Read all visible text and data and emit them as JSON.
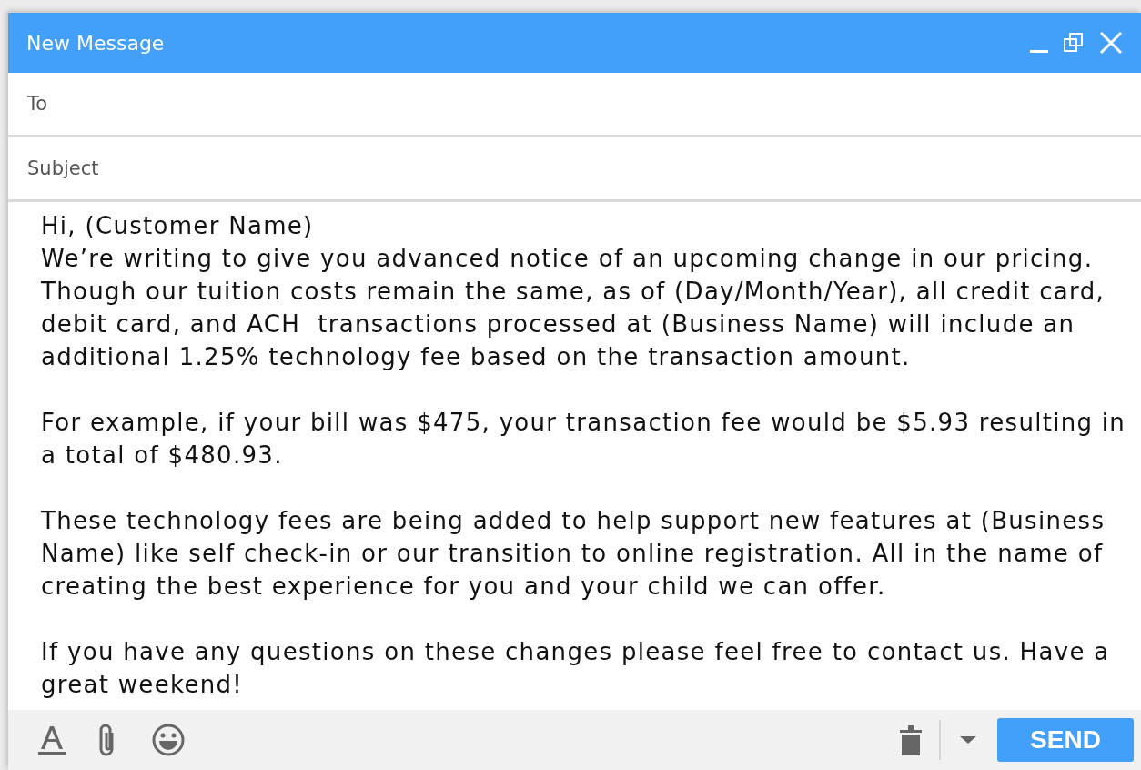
{
  "window": {
    "title": "New Message"
  },
  "fields": [
    {
      "label": "To"
    },
    {
      "label": "Subject"
    }
  ],
  "body": [
    {
      "kind": "greeting",
      "text": "Hi, (Customer Name)"
    },
    {
      "kind": "paragraph",
      "text": "We’re writing to give you advanced notice of an upcoming change in our pricing. Though our tuition costs remain the same, as of (Day/Month/Year), all credit card, debit card, and ACH  transactions processed at (Business Name) will include an additional 1.25% technology fee based on the transaction amount."
    },
    {
      "kind": "paragraph",
      "text": "For example, if your bill was $475, your transaction fee would be $5.93 resulting in a total of $480.93."
    },
    {
      "kind": "paragraph",
      "text": "These technology fees are being added to help support new features at (Business Name) like self check-in or our transition to online registration. All in the name of creating the best experience for you and your child we can offer."
    },
    {
      "kind": "paragraph",
      "text": "If you have any questions on these changes please feel free to contact us. Have a great weekend!"
    }
  ],
  "send_button": "SEND"
}
